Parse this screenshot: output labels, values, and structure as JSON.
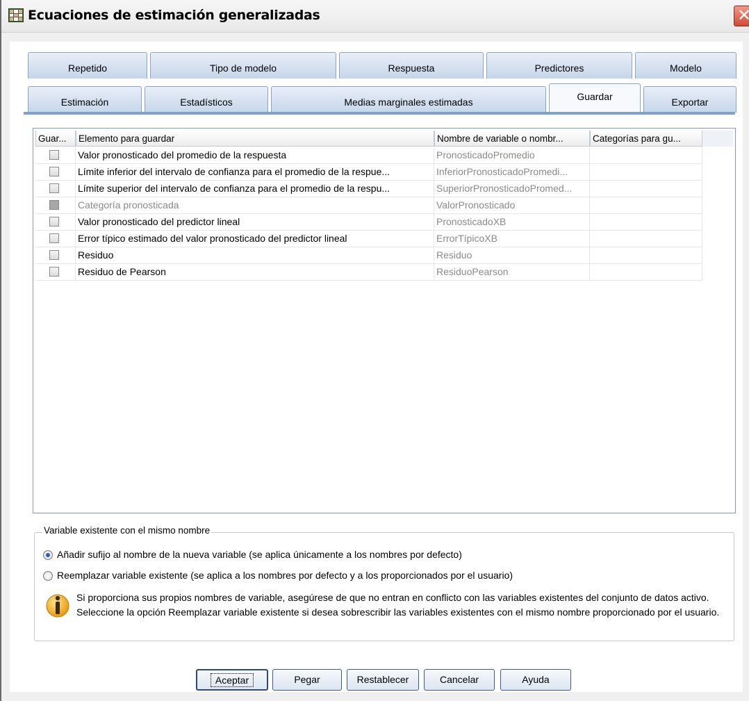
{
  "window": {
    "title": "Ecuaciones de estimación generalizadas",
    "close_glyph": "✕"
  },
  "tabs_row1": [
    {
      "label": "Repetido"
    },
    {
      "label": "Tipo de modelo"
    },
    {
      "label": "Respuesta"
    },
    {
      "label": "Predictores"
    },
    {
      "label": "Modelo"
    }
  ],
  "tabs_row2": [
    {
      "label": "Estimación"
    },
    {
      "label": "Estadísticos"
    },
    {
      "label": "Medias marginales estimadas"
    },
    {
      "label": "Guardar",
      "selected": true
    },
    {
      "label": "Exportar"
    }
  ],
  "table": {
    "headers": [
      "Guar...",
      "Elemento para guardar",
      "Nombre de variable o nombr...",
      "Categorías para gu..."
    ],
    "rows": [
      {
        "item": "Valor pronosticado del promedio de la respuesta",
        "name": "PronosticadoPromedio",
        "checked": false,
        "disabled": false
      },
      {
        "item": "Límite inferior del intervalo de confianza para el promedio de la respue...",
        "name": "InferiorPronosticadoPromedi...",
        "checked": false,
        "disabled": false
      },
      {
        "item": "Límite superior del intervalo de confianza para el promedio de la respu...",
        "name": "SuperiorPronosticadoPromed...",
        "checked": false,
        "disabled": false
      },
      {
        "item": "Categoría pronosticada",
        "name": "ValorPronosticado",
        "checked": false,
        "disabled": true
      },
      {
        "item": "Valor pronosticado del predictor lineal",
        "name": "PronosticadoXB",
        "checked": false,
        "disabled": false
      },
      {
        "item": "Error típico estimado del valor pronosticado del predictor lineal",
        "name": "ErrorTípicoXB",
        "checked": false,
        "disabled": false
      },
      {
        "item": "Residuo",
        "name": "Residuo",
        "checked": false,
        "disabled": false
      },
      {
        "item": "Residuo de Pearson",
        "name": "ResiduoPearson",
        "checked": false,
        "disabled": false
      }
    ]
  },
  "existing_var": {
    "legend": "Variable existente con el mismo nombre",
    "option1": "Añadir sufijo al nombre de la nueva variable (se aplica únicamente a los nombres por defecto)",
    "option2": "Reemplazar variable existente (se aplica a los nombres por defecto y a los proporcionados por el usuario)",
    "selected": "option1",
    "info": "Si proporciona sus propios nombres de variable, asegúrese de que no entran en conflicto con las variables existentes del conjunto de datos activo. Seleccione la opción Reemplazar variable existente si desea sobrescribir las variables existentes con el mismo nombre proporcionado por el usuario."
  },
  "buttons": {
    "ok": "Aceptar",
    "paste": "Pegar",
    "reset": "Restablecer",
    "cancel": "Cancelar",
    "help": "Ayuda"
  }
}
